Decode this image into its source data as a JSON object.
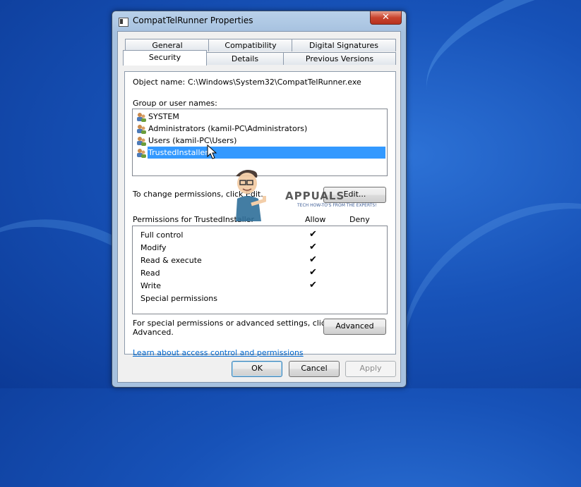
{
  "window": {
    "title": "CompatTelRunner Properties",
    "close_label": "✕"
  },
  "tabs": {
    "row1": [
      "General",
      "Compatibility",
      "Digital Signatures"
    ],
    "row2": [
      "Security",
      "Details",
      "Previous Versions"
    ],
    "active": "Security"
  },
  "security": {
    "object_name_label": "Object name:",
    "object_name_value": "C:\\Windows\\System32\\CompatTelRunner.exe",
    "group_label": "Group or user names:",
    "users": [
      {
        "name": "SYSTEM",
        "selected": false
      },
      {
        "name": "Administrators (kamil-PC\\Administrators)",
        "selected": false
      },
      {
        "name": "Users (kamil-PC\\Users)",
        "selected": false
      },
      {
        "name": "TrustedInstaller",
        "selected": true
      }
    ],
    "change_text": "To change permissions, click Edit.",
    "edit_button": "Edit...",
    "permissions_label": "Permissions for TrustedInstaller",
    "allow_header": "Allow",
    "deny_header": "Deny",
    "permissions": [
      {
        "name": "Full control",
        "allow": true,
        "deny": false
      },
      {
        "name": "Modify",
        "allow": true,
        "deny": false
      },
      {
        "name": "Read & execute",
        "allow": true,
        "deny": false
      },
      {
        "name": "Read",
        "allow": true,
        "deny": false
      },
      {
        "name": "Write",
        "allow": true,
        "deny": false
      },
      {
        "name": "Special permissions",
        "allow": false,
        "deny": false
      }
    ],
    "special_text_line1": "For special permissions or advanced settings, click",
    "special_text_line2": "Advanced.",
    "advanced_button": "Advanced",
    "learn_link": "Learn about access control and permissions"
  },
  "footer": {
    "ok": "OK",
    "cancel": "Cancel",
    "apply": "Apply"
  },
  "watermark": {
    "brand": "APPUALS",
    "tagline": "TECH HOW-TO'S FROM THE EXPERTS!"
  },
  "colors": {
    "selection": "#3399ff",
    "link": "#0066cc",
    "desktop": "#1752b8"
  }
}
